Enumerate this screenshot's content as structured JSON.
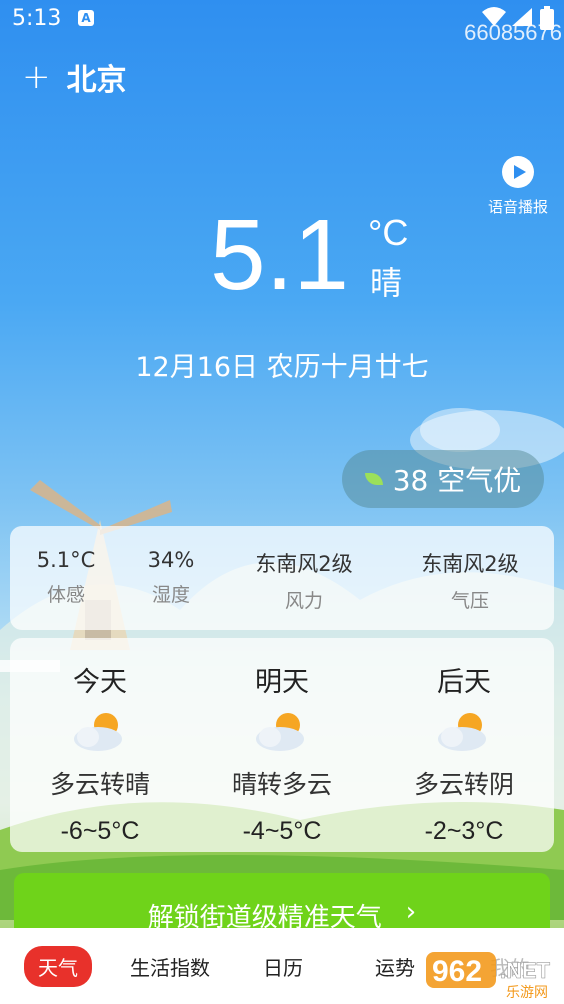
{
  "status": {
    "time": "5:13",
    "app_badge": "A"
  },
  "overlay_id": "66085676",
  "header": {
    "add_icon": "plus-icon",
    "city": "北京"
  },
  "voice": {
    "label": "语音播报",
    "icon": "play-icon"
  },
  "current": {
    "temp": "5.1",
    "unit": "°C",
    "condition": "晴",
    "date": "12月16日 农历十月廿七"
  },
  "aqi": {
    "label": "38 空气优",
    "icon": "leaf-icon"
  },
  "details": [
    {
      "value": "5.1°C",
      "key": "体感"
    },
    {
      "value": "34%",
      "key": "湿度"
    },
    {
      "value": "东南风2级",
      "key": "风力"
    },
    {
      "value": "东南风2级",
      "key": "气压"
    }
  ],
  "forecast": [
    {
      "day": "今天",
      "icon": "partly-cloudy-icon",
      "desc": "多云转晴",
      "range": "-6~5°C"
    },
    {
      "day": "明天",
      "icon": "partly-cloudy-icon",
      "desc": "晴转多云",
      "range": "-4~5°C"
    },
    {
      "day": "后天",
      "icon": "partly-cloudy-icon",
      "desc": "多云转阴",
      "range": "-2~3°C"
    }
  ],
  "unlock": {
    "label": "解锁街道级精准天气",
    "chevron": "›"
  },
  "tabs": [
    {
      "label": "天气",
      "active": true
    },
    {
      "label": "生活指数"
    },
    {
      "label": "日历"
    },
    {
      "label": "运势"
    },
    {
      "label": "我的"
    }
  ],
  "watermark": {
    "brand": "962",
    "net": ".NET",
    "sub": "乐游网"
  },
  "colors": {
    "accent": "#e8312b",
    "unlock": "#6fd31a",
    "sky": "#2f8ff0"
  }
}
